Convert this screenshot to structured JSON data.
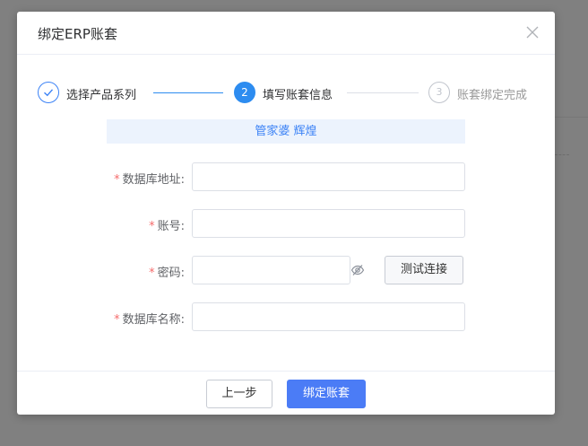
{
  "dialog": {
    "title": "绑定ERP账套"
  },
  "steps": [
    {
      "label": "选择产品系列",
      "number": "✓",
      "status": "done"
    },
    {
      "label": "填写账套信息",
      "number": "2",
      "status": "active"
    },
    {
      "label": "账套绑定完成",
      "number": "3",
      "status": "pending"
    }
  ],
  "banner": {
    "text": "管家婆 辉煌"
  },
  "form": {
    "required_mark": "*",
    "db_address": {
      "label": "数据库地址:",
      "value": "",
      "placeholder": ""
    },
    "account": {
      "label": "账号:",
      "value": "",
      "placeholder": ""
    },
    "password": {
      "label": "密码:",
      "value": "",
      "placeholder": ""
    },
    "db_name": {
      "label": "数据库名称:",
      "value": "",
      "placeholder": ""
    },
    "test_button": "测试连接"
  },
  "footer": {
    "prev_button": "上一步",
    "bind_button": "绑定账套"
  },
  "colors": {
    "accent": "#2d8cf0",
    "primary_button": "#4b7cf6",
    "banner_bg": "#ecf3fd",
    "required": "#f56c6c"
  },
  "icons": [
    "close-icon",
    "check-icon",
    "eye-hidden-icon"
  ]
}
